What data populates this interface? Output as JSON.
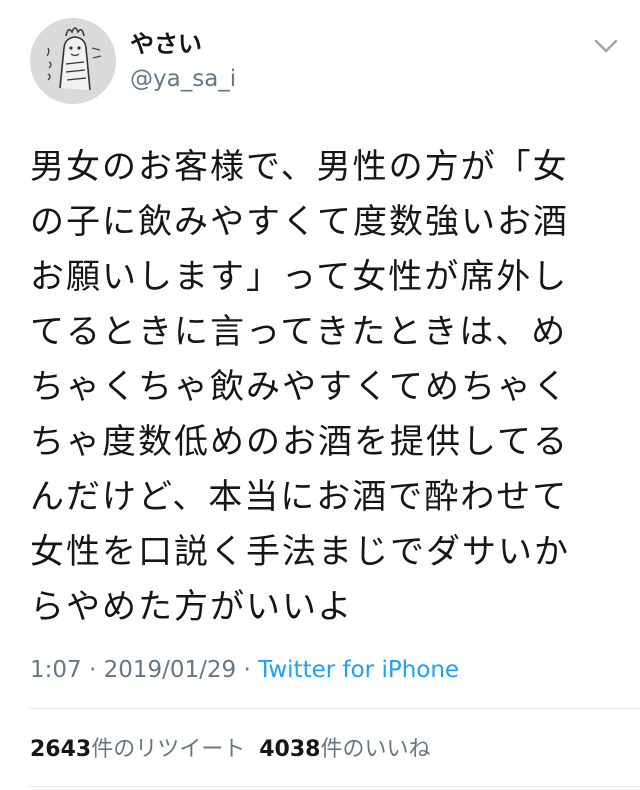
{
  "user": {
    "display_name": "やさい",
    "handle": "@ya_sa_i"
  },
  "icons": {
    "avatar": "avatar-illustration",
    "menu": "chevron-down-icon"
  },
  "tweet": {
    "lines": [
      "男女のお客様で、男性の方が「女",
      "の子に飲みやすくて度数強いお酒",
      "お願いします」って女性が席外し",
      "てるときに言ってきたときは、め",
      "ちゃくちゃ飲みやすくてめちゃく",
      "ちゃ度数低めのお酒を提供してる",
      "んだけど、本当にお酒で酔わせて",
      "女性を口説く手法まじでダサいか",
      "らやめた方がいいよ"
    ],
    "time": "1:07",
    "date": "2019/01/29",
    "separator": "·",
    "source": "Twitter for iPhone"
  },
  "stats": {
    "retweets_count": "2643",
    "retweets_label": "件のリツイート",
    "likes_count": "4038",
    "likes_label": "件のいいね"
  },
  "colors": {
    "text": "#14171a",
    "secondary": "#657786",
    "link": "#1da1f2",
    "divider": "#e1e8ed"
  }
}
